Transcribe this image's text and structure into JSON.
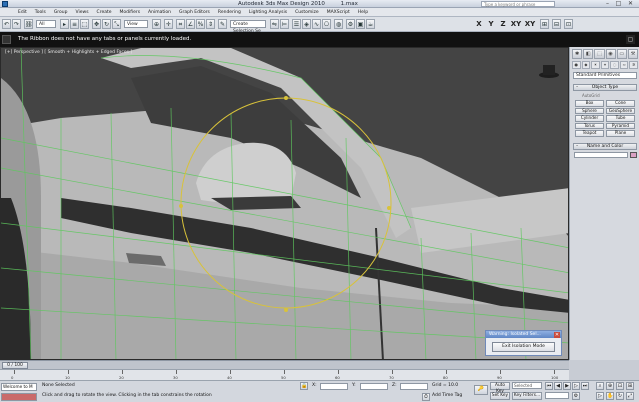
{
  "window": {
    "title": "Autodesk 3ds Max Design 2010",
    "file": "1.max",
    "search_placeholder": "Type a keyword or phrase",
    "minimize_glyph": "–",
    "maximize_glyph": "□",
    "close_glyph": "✕"
  },
  "menu": {
    "items": [
      "Edit",
      "Tools",
      "Group",
      "Views",
      "Create",
      "Modifiers",
      "Animation",
      "Graph Editors",
      "Rendering",
      "Lighting Analysis",
      "Customize",
      "MAXScript",
      "Help"
    ]
  },
  "toolbar": {
    "filter_value": "All",
    "reference_coord": "View",
    "named_selection": "Create Selection Se",
    "axis_labels": [
      "X",
      "Y",
      "Z",
      "XY",
      "XY"
    ]
  },
  "ribbon": {
    "message": "The Ribbon does not have any tabs or panels currently loaded."
  },
  "viewport": {
    "label": "[+] Perspective ] [ Smooth + Highlights + Edged Faces ]",
    "background": "#444444",
    "mesh_color": "#bdbdbd",
    "wire_color": "#5ec85e",
    "gizmo_color": "#d8c23a"
  },
  "dialog": {
    "title": "Warning: Isolated Sel...",
    "close_glyph": "✕",
    "button_label": "Exit Isolation Mode"
  },
  "command_panel": {
    "tab_icons": [
      "✱",
      "◧",
      "⬚",
      "◉",
      "▭",
      "⚒"
    ],
    "subtab_icons": [
      "●",
      "◆",
      "☀",
      "⌖",
      "◌",
      "≈",
      "✲"
    ],
    "category": "Standard Primitives",
    "object_type_title": "Object Type",
    "autogrid_label": "AutoGrid",
    "primitives": [
      "Box",
      "Cone",
      "Sphere",
      "GeoSphere",
      "Cylinder",
      "Tube",
      "Torus",
      "Pyramid",
      "Teapot",
      "Plane"
    ],
    "name_color_title": "Name and Color",
    "swatch_color": "#d9a0c2"
  },
  "timeline": {
    "frame_display": "0 / 100",
    "ticks": [
      "0",
      "10",
      "20",
      "30",
      "40",
      "50",
      "60",
      "70",
      "80",
      "90",
      "100"
    ]
  },
  "status": {
    "maxscript_text": "Welcome to M",
    "selection_status": "None Selected",
    "prompt": "Click and drag to rotate the view.  Clicking in the tab constrains the rotation",
    "x_label": "X:",
    "y_label": "Y:",
    "z_label": "Z:",
    "grid": "Grid = 10.0",
    "add_time_tag": "Add Time Tag",
    "auto_key": "Auto Key",
    "selected_dropdown": "Selected",
    "set_key": "Set Key",
    "key_filters": "Key Filters...",
    "accent_color": "#c94b3c"
  }
}
